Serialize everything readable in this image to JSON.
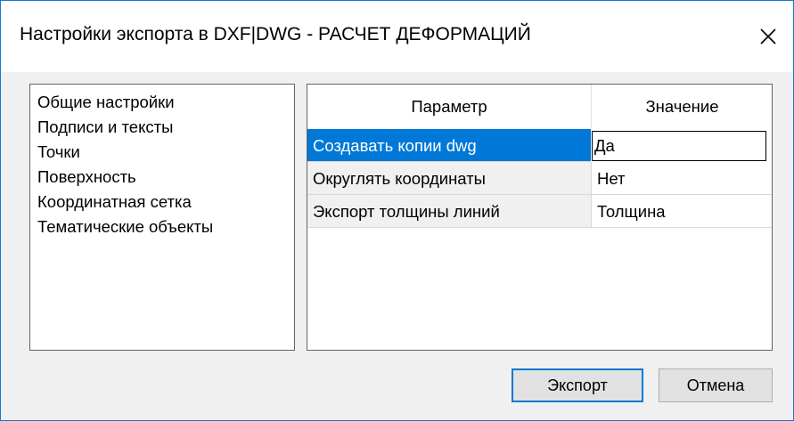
{
  "window": {
    "title": "Настройки экспорта в DXF|DWG - РАСЧЕТ ДЕФОРМАЦИЙ",
    "close_icon": "close-icon"
  },
  "nav": {
    "items": [
      {
        "label": "Общие настройки"
      },
      {
        "label": "Подписи и тексты"
      },
      {
        "label": "Точки"
      },
      {
        "label": "Поверхность"
      },
      {
        "label": "Координатная сетка"
      },
      {
        "label": "Тематические объекты"
      }
    ]
  },
  "grid": {
    "columns": [
      "Параметр",
      "Значение"
    ],
    "rows": [
      {
        "param": "Создавать копии dwg",
        "value": "Да",
        "selected": true,
        "editing": true
      },
      {
        "param": "Округлять координаты",
        "value": "Нет"
      },
      {
        "param": "Экспорт толщины линий",
        "value": "Толщина"
      }
    ]
  },
  "buttons": {
    "export_label": "Экспорт",
    "cancel_label": "Отмена"
  },
  "colors": {
    "accent": "#0078d7",
    "window_border": "#1979ca",
    "dialog_bg": "#f0f0f0"
  }
}
